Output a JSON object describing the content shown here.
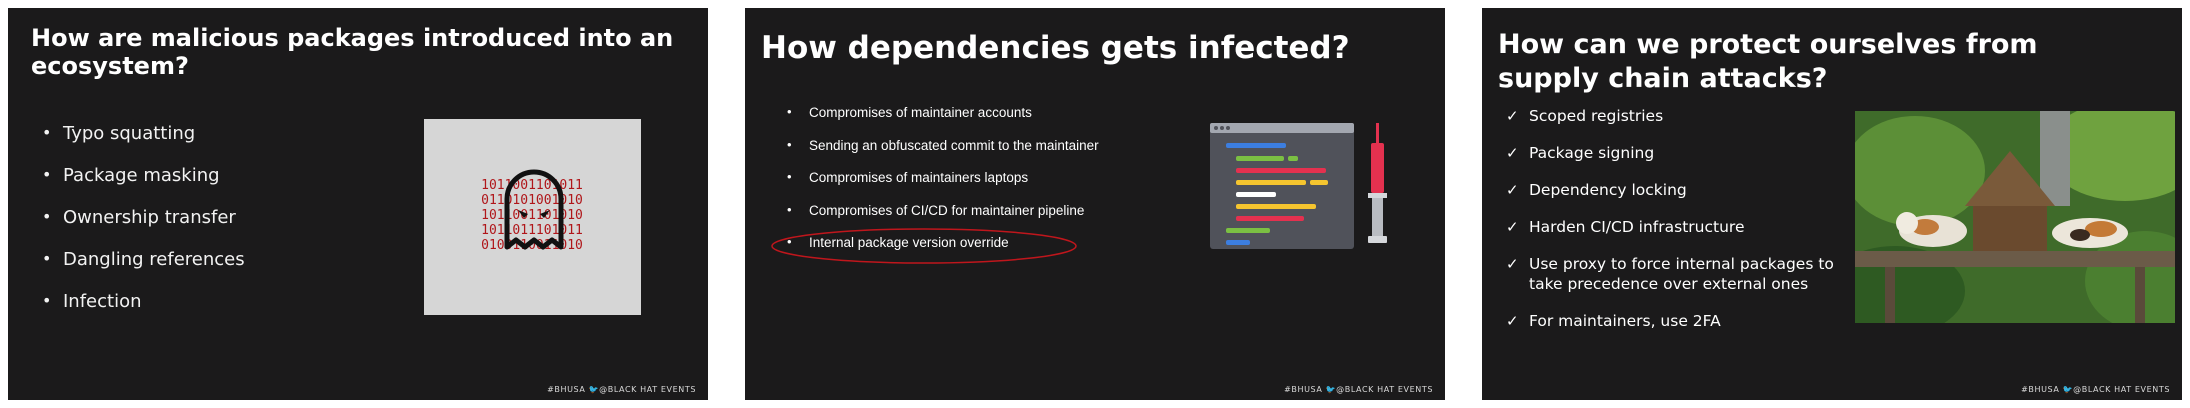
{
  "slide1": {
    "title": "How are malicious packages introduced into an ecosystem?",
    "bullets": [
      "Typo squatting",
      "Package masking",
      "Ownership transfer",
      "Dangling references",
      "Infection"
    ],
    "binary_rows": [
      "1011001101011",
      "0110101001010",
      "1011001101010",
      "1011011101011",
      "0100110011010"
    ],
    "footer": "#BHUSA 🐦@BLACK HAT EVENTS"
  },
  "slide2": {
    "title": "How dependencies gets infected?",
    "bullets": [
      "Compromises of maintainer accounts",
      "Sending an obfuscated commit to the maintainer",
      "Compromises of maintainers laptops",
      "Compromises of CI/CD for maintainer pipeline",
      "Internal package version override"
    ],
    "footer": "#BHUSA 🐦@BLACK HAT EVENTS"
  },
  "slide3": {
    "title": "How can we protect ourselves from supply chain attacks?",
    "bullets": [
      "Scoped registries",
      "Package signing",
      "Dependency locking",
      "Harden CI/CD infrastructure",
      "Use proxy to force internal packages to take precedence over external ones",
      "For maintainers, use 2FA"
    ],
    "check_glyph": "✓",
    "footer": "#BHUSA 🐦@BLACK HAT EVENTS"
  },
  "colors": {
    "slide_bg": "#1b1a1b",
    "highlight_red": "#c0161c",
    "binary_red": "#b0161a"
  },
  "icons": [
    "ghost-icon",
    "code-editor-icon",
    "syringe-icon",
    "cat-birdhouse-photo"
  ]
}
